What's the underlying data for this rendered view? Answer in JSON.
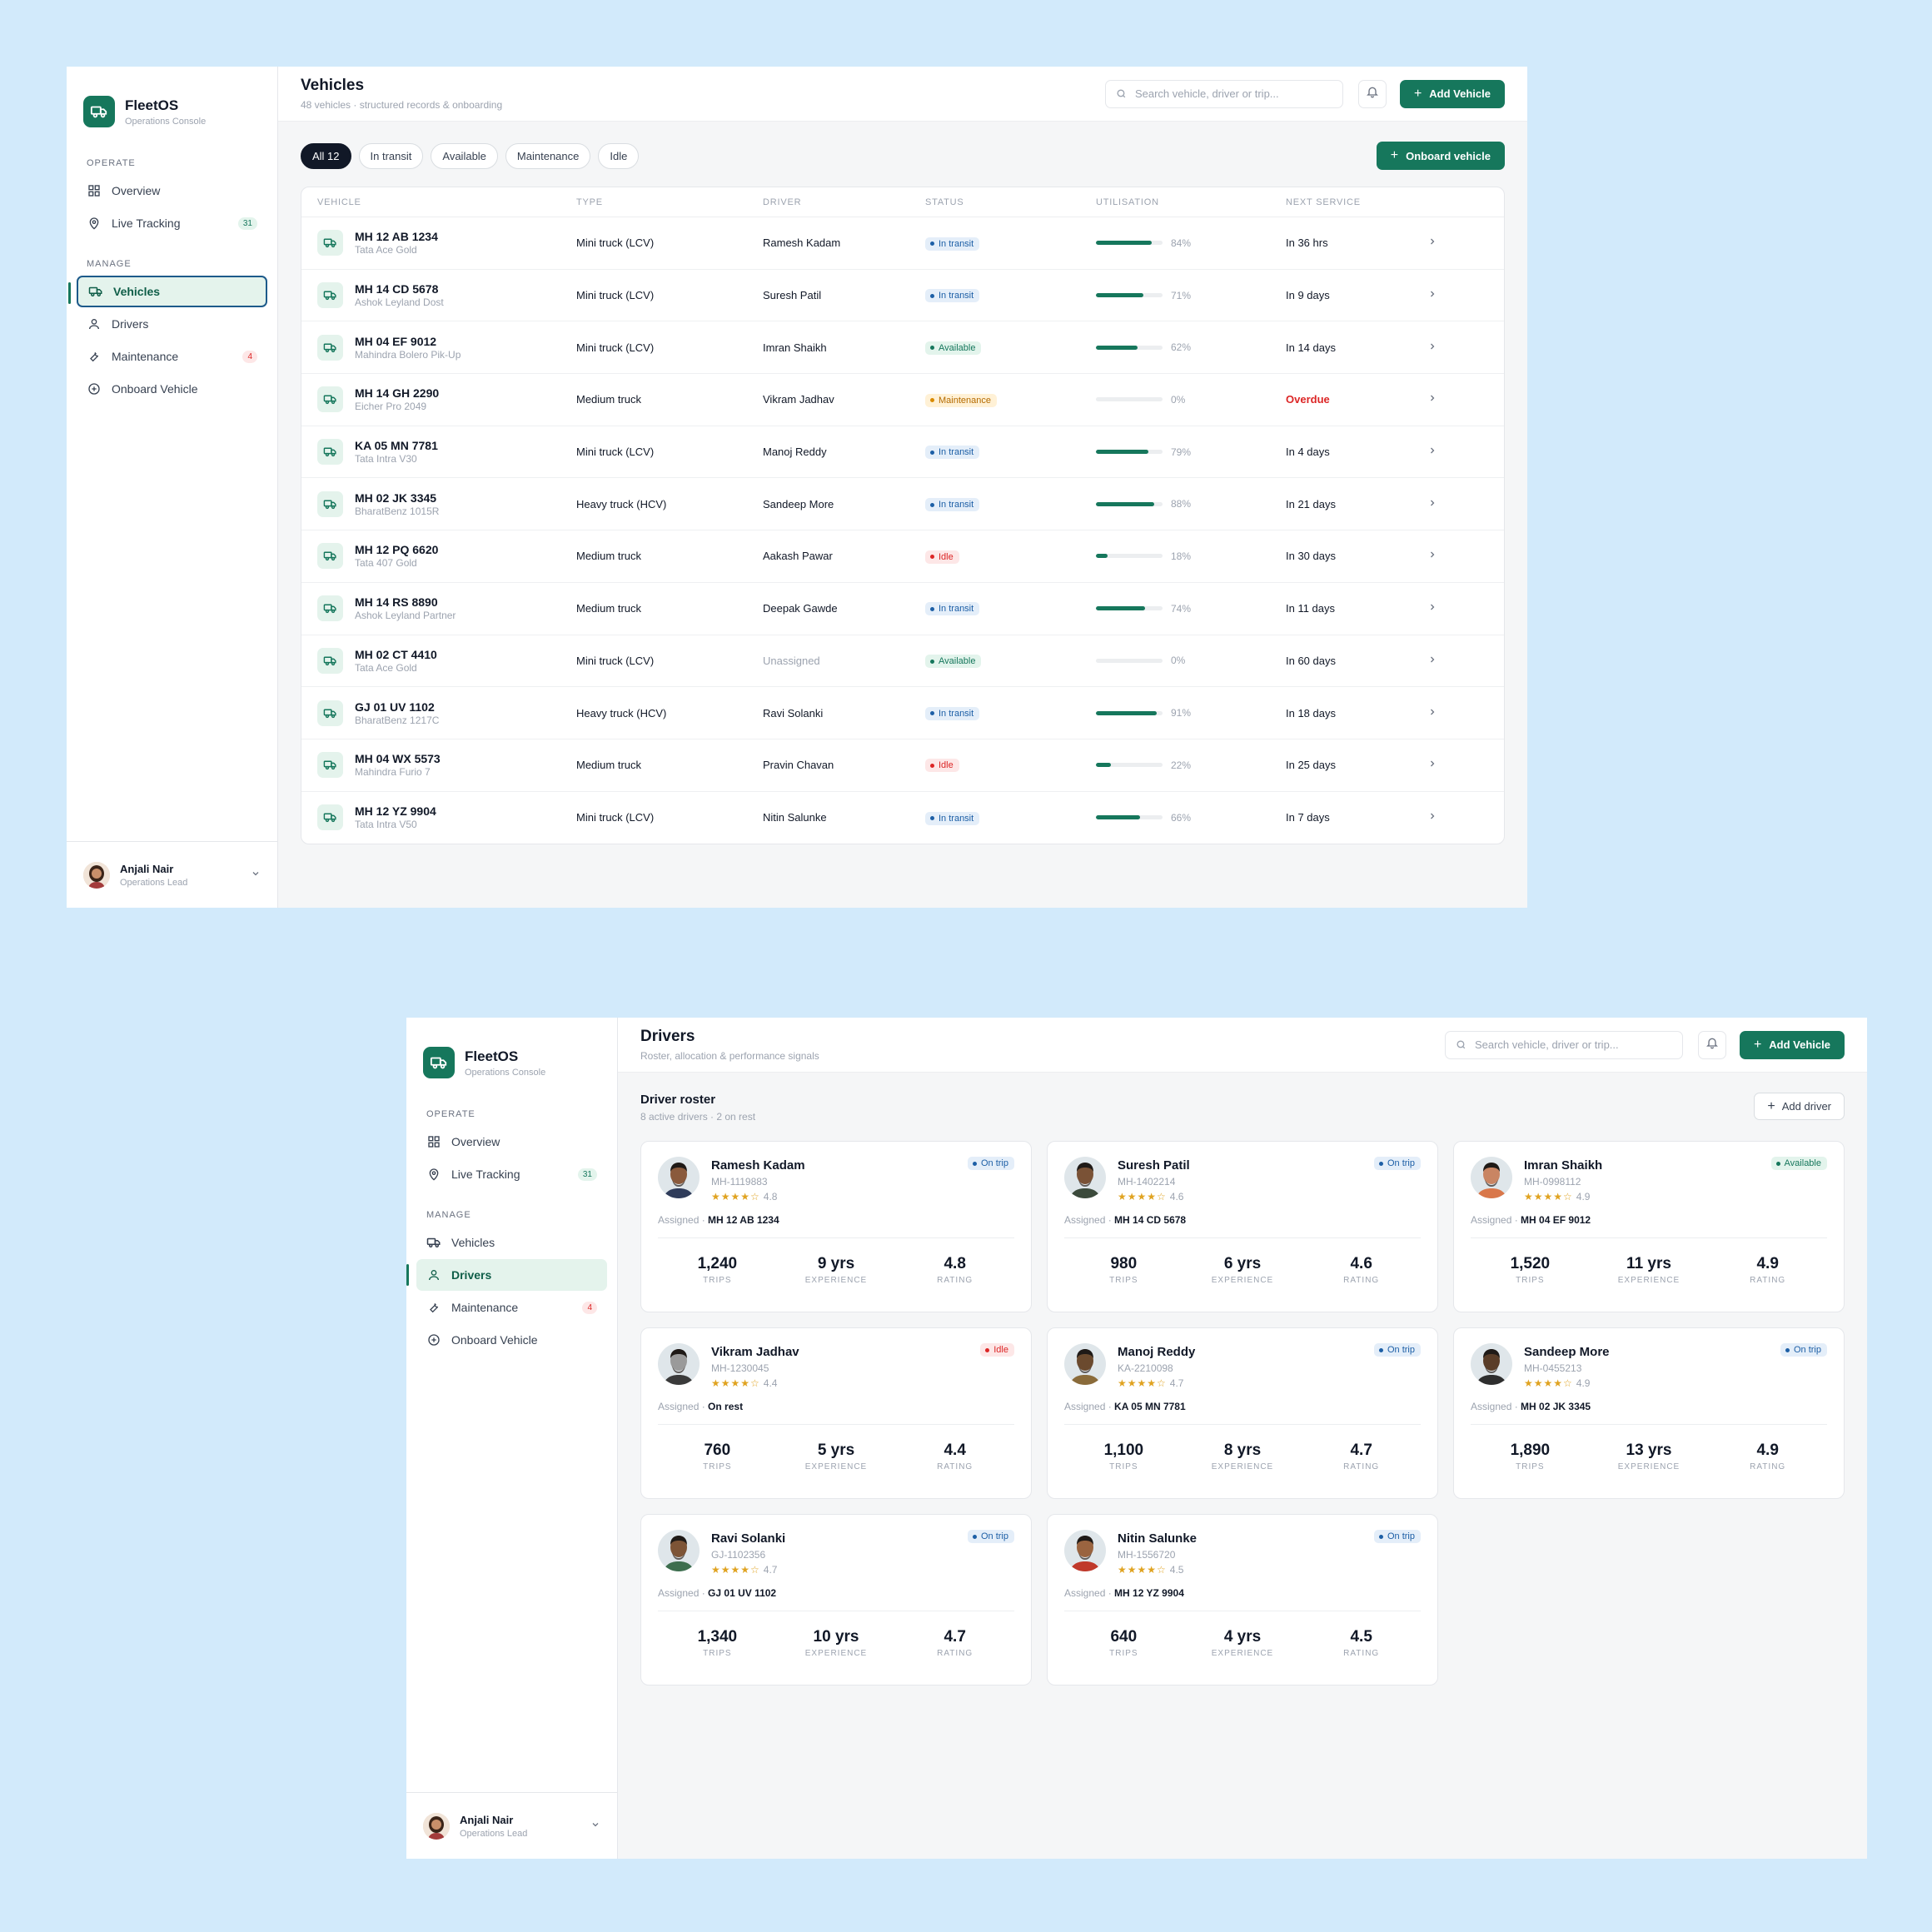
{
  "brand": {
    "name": "FleetOS",
    "subtitle": "Operations Console"
  },
  "colors": {
    "accent": "#16775c",
    "transit": "#1d5fa6",
    "maintenance": "#d98a00",
    "idle": "#dc2626",
    "background": "#d2eafb"
  },
  "sidebar": {
    "operate_label": "OPERATE",
    "manage_label": "MANAGE",
    "items": [
      {
        "label": "Overview",
        "icon": "grid-icon"
      },
      {
        "label": "Live Tracking",
        "icon": "map-pin-icon",
        "badge": "31"
      },
      {
        "label": "Vehicles",
        "icon": "truck-icon"
      },
      {
        "label": "Drivers",
        "icon": "user-icon"
      },
      {
        "label": "Maintenance",
        "icon": "wrench-icon",
        "badge": "4"
      },
      {
        "label": "Onboard Vehicle",
        "icon": "plus-circle-icon"
      }
    ]
  },
  "user": {
    "name": "Anjali Nair",
    "role": "Operations Lead"
  },
  "header": {
    "search_placeholder": "Search vehicle, driver or trip...",
    "add_vehicle": "Add Vehicle"
  },
  "vehicles_page": {
    "title": "Vehicles",
    "subtitle": "48 vehicles · structured records & onboarding",
    "filters": [
      "All 12",
      "In transit",
      "Available",
      "Maintenance",
      "Idle"
    ],
    "onboard_button": "Onboard vehicle",
    "columns": [
      "VEHICLE",
      "TYPE",
      "DRIVER",
      "STATUS",
      "UTILISATION",
      "NEXT SERVICE"
    ],
    "rows": [
      {
        "plate": "MH 12 AB 1234",
        "model": "Tata Ace Gold",
        "type": "Mini truck (LCV)",
        "driver": "Ramesh Kadam",
        "status": "In transit",
        "util": 84,
        "util_label": "84%",
        "next": "In 36 hrs"
      },
      {
        "plate": "MH 14 CD 5678",
        "model": "Ashok Leyland Dost",
        "type": "Mini truck (LCV)",
        "driver": "Suresh Patil",
        "status": "In transit",
        "util": 71,
        "util_label": "71%",
        "next": "In 9 days"
      },
      {
        "plate": "MH 04 EF 9012",
        "model": "Mahindra Bolero Pik-Up",
        "type": "Mini truck (LCV)",
        "driver": "Imran Shaikh",
        "status": "Available",
        "util": 62,
        "util_label": "62%",
        "next": "In 14 days"
      },
      {
        "plate": "MH 14 GH 2290",
        "model": "Eicher Pro 2049",
        "type": "Medium truck",
        "driver": "Vikram Jadhav",
        "status": "Maintenance",
        "util": 0,
        "util_label": "0%",
        "next": "Overdue"
      },
      {
        "plate": "KA 05 MN 7781",
        "model": "Tata Intra V30",
        "type": "Mini truck (LCV)",
        "driver": "Manoj Reddy",
        "status": "In transit",
        "util": 79,
        "util_label": "79%",
        "next": "In 4 days"
      },
      {
        "plate": "MH 02 JK 3345",
        "model": "BharatBenz 1015R",
        "type": "Heavy truck (HCV)",
        "driver": "Sandeep More",
        "status": "In transit",
        "util": 88,
        "util_label": "88%",
        "next": "In 21 days"
      },
      {
        "plate": "MH 12 PQ 6620",
        "model": "Tata 407 Gold",
        "type": "Medium truck",
        "driver": "Aakash Pawar",
        "status": "Idle",
        "util": 18,
        "util_label": "18%",
        "next": "In 30 days"
      },
      {
        "plate": "MH 14 RS 8890",
        "model": "Ashok Leyland Partner",
        "type": "Medium truck",
        "driver": "Deepak Gawde",
        "status": "In transit",
        "util": 74,
        "util_label": "74%",
        "next": "In 11 days"
      },
      {
        "plate": "MH 02 CT 4410",
        "model": "Tata Ace Gold",
        "type": "Mini truck (LCV)",
        "driver": "Unassigned",
        "status": "Available",
        "util": 0,
        "util_label": "0%",
        "next": "In 60 days"
      },
      {
        "plate": "GJ 01 UV 1102",
        "model": "BharatBenz 1217C",
        "type": "Heavy truck (HCV)",
        "driver": "Ravi Solanki",
        "status": "In transit",
        "util": 91,
        "util_label": "91%",
        "next": "In 18 days"
      },
      {
        "plate": "MH 04 WX 5573",
        "model": "Mahindra Furio 7",
        "type": "Medium truck",
        "driver": "Pravin Chavan",
        "status": "Idle",
        "util": 22,
        "util_label": "22%",
        "next": "In 25 days"
      },
      {
        "plate": "MH 12 YZ 9904",
        "model": "Tata Intra V50",
        "type": "Mini truck (LCV)",
        "driver": "Nitin Salunke",
        "status": "In transit",
        "util": 66,
        "util_label": "66%",
        "next": "In 7 days"
      }
    ]
  },
  "drivers_page": {
    "title": "Drivers",
    "subtitle": "Roster, allocation & performance signals",
    "roster_title": "Driver roster",
    "roster_sub": "8 active drivers · 2 on rest",
    "add_driver": "Add driver",
    "assigned_label": "Assigned ·",
    "stat_labels": [
      "TRIPS",
      "EXPERIENCE",
      "RATING"
    ],
    "drivers": [
      {
        "name": "Ramesh Kadam",
        "code": "MH-1119883",
        "stars": 4,
        "rating": "4.8",
        "status": "On trip",
        "assigned": "MH 12 AB 1234",
        "trips": "1,240",
        "experience": "9 yrs",
        "skin": "#8a5a3c",
        "shirt": "#2f3c5a"
      },
      {
        "name": "Suresh Patil",
        "code": "MH-1402214",
        "stars": 4,
        "rating": "4.6",
        "status": "On trip",
        "assigned": "MH 14 CD 5678",
        "trips": "980",
        "experience": "6 yrs",
        "skin": "#7a5236",
        "shirt": "#3b4a3b"
      },
      {
        "name": "Imran Shaikh",
        "code": "MH-0998112",
        "stars": 4,
        "rating": "4.9",
        "status": "Available",
        "assigned": "MH 04 EF 9012",
        "trips": "1,520",
        "experience": "11 yrs",
        "skin": "#c98563",
        "shirt": "#d9774a"
      },
      {
        "name": "Vikram Jadhav",
        "code": "MH-1230045",
        "stars": 4,
        "rating": "4.4",
        "status": "Idle",
        "assigned": "On rest",
        "trips": "760",
        "experience": "5 yrs",
        "skin": "#9a9a9a",
        "shirt": "#3a3a3a"
      },
      {
        "name": "Manoj Reddy",
        "code": "KA-2210098",
        "stars": 4,
        "rating": "4.7",
        "status": "On trip",
        "assigned": "KA 05 MN 7781",
        "trips": "1,100",
        "experience": "8 yrs",
        "skin": "#6b4a2e",
        "shirt": "#8a6b3a"
      },
      {
        "name": "Sandeep More",
        "code": "MH-0455213",
        "stars": 4,
        "rating": "4.9",
        "status": "On trip",
        "assigned": "MH 02 JK 3345",
        "trips": "1,890",
        "experience": "13 yrs",
        "skin": "#5a3d28",
        "shirt": "#2e2e2e"
      },
      {
        "name": "Ravi Solanki",
        "code": "GJ-1102356",
        "stars": 4,
        "rating": "4.7",
        "status": "On trip",
        "assigned": "GJ 01 UV 1102",
        "trips": "1,340",
        "experience": "10 yrs",
        "skin": "#7d5436",
        "shirt": "#3d6e4e"
      },
      {
        "name": "Nitin Salunke",
        "code": "MH-1556720",
        "stars": 4,
        "rating": "4.5",
        "status": "On trip",
        "assigned": "MH 12 YZ 9904",
        "trips": "640",
        "experience": "4 yrs",
        "skin": "#9a6440",
        "shirt": "#c0392b"
      }
    ]
  }
}
